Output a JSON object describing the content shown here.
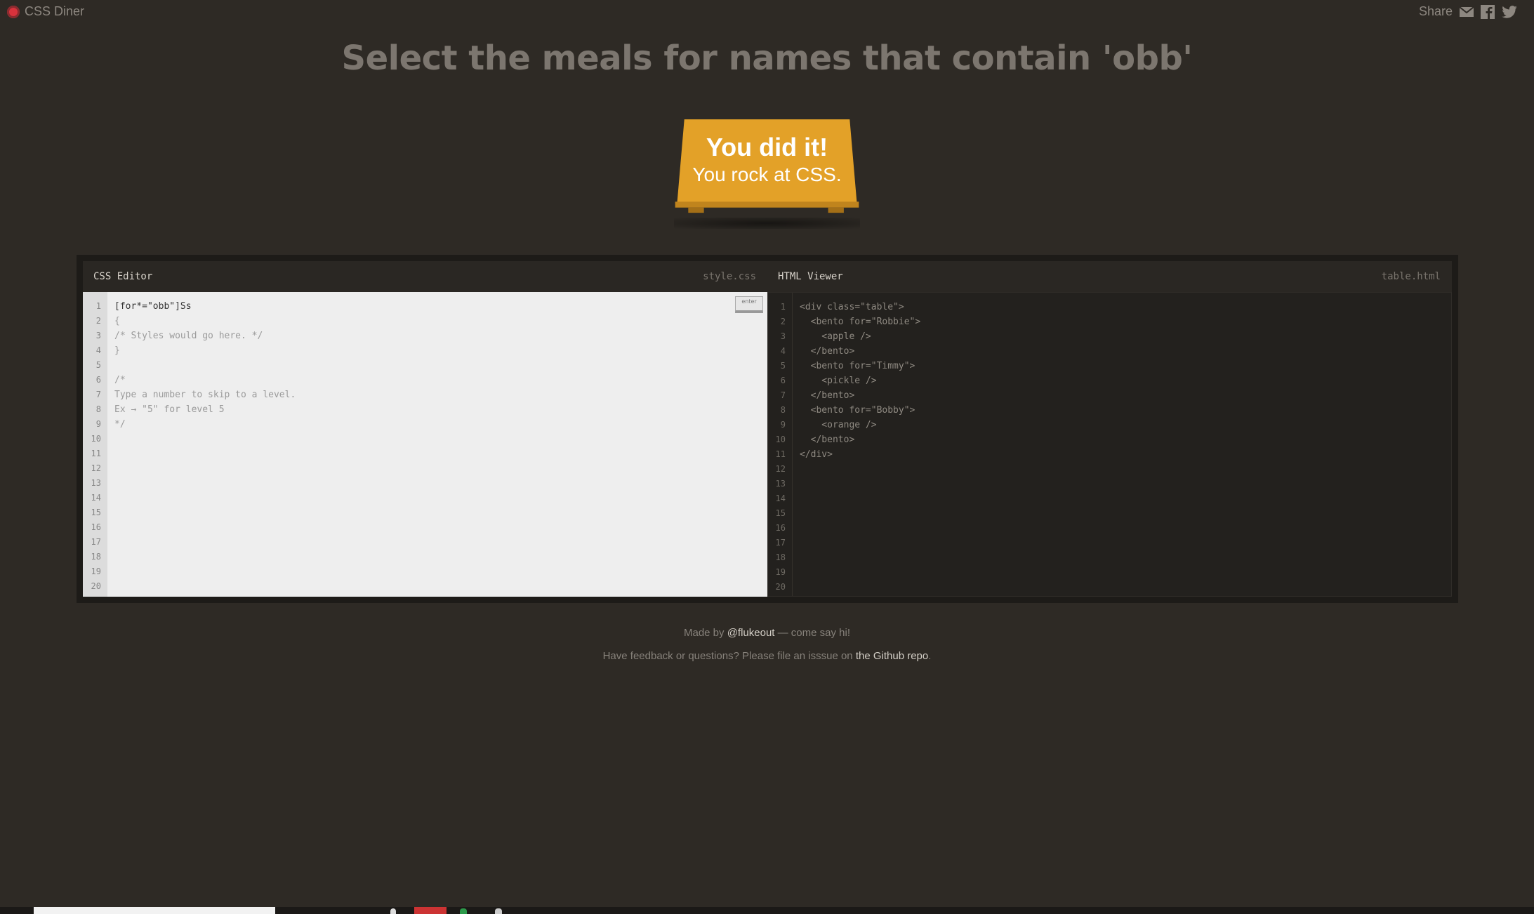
{
  "app": {
    "title": "CSS Diner"
  },
  "share": {
    "label": "Share",
    "icons": [
      "email-icon",
      "facebook-icon",
      "twitter-icon"
    ]
  },
  "instruction": "Select the meals for names that contain 'obb'",
  "success": {
    "line1": "You did it!",
    "line2": "You rock at CSS."
  },
  "css_editor": {
    "title": "CSS Editor",
    "filename": "style.css",
    "enter_label": "enter",
    "line_numbers": [
      "1",
      "2",
      "3",
      "4",
      "5",
      "6",
      "7",
      "8",
      "9",
      "10",
      "11",
      "12",
      "13",
      "14",
      "15",
      "16",
      "17",
      "18",
      "19",
      "20"
    ],
    "input_value": "[for*=\"obb\"]Ss",
    "lines": [
      "{",
      "/* Styles would go here. */",
      "}",
      "",
      "/*",
      "Type a number to skip to a level.",
      "Ex → \"5\" for level 5",
      "*/"
    ]
  },
  "html_viewer": {
    "title": "HTML Viewer",
    "filename": "table.html",
    "line_numbers": [
      "1",
      "2",
      "3",
      "4",
      "5",
      "6",
      "7",
      "8",
      "9",
      "10",
      "11",
      "12",
      "13",
      "14",
      "15",
      "16",
      "17",
      "18",
      "19",
      "20"
    ],
    "lines": [
      "<div class=\"table\">",
      "  <bento for=\"Robbie\">",
      "    <apple />",
      "  </bento>",
      "  <bento for=\"Timmy\">",
      "    <pickle />",
      "  </bento>",
      "  <bento for=\"Bobby\">",
      "    <orange />",
      "  </bento>",
      "</div>"
    ]
  },
  "footer": {
    "made_by_prefix": "Made by ",
    "made_by_link": "@flukeout",
    "made_by_suffix": " — come say hi!",
    "feedback_prefix": "Have feedback or questions? Please file an isssue on ",
    "feedback_link": "the Github repo",
    "feedback_suffix": "."
  },
  "colors": {
    "background": "#2e2a25",
    "table": "#e3a128",
    "css_pane": "#eeeeee",
    "html_pane": "#23211e"
  }
}
